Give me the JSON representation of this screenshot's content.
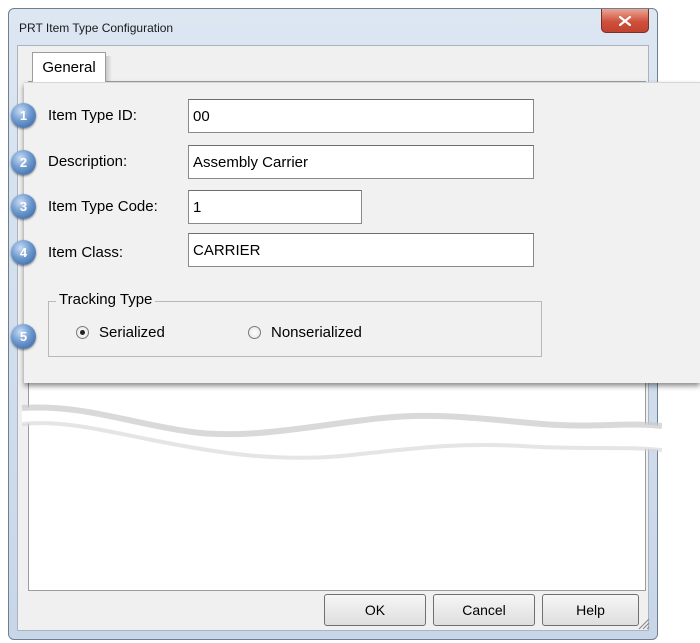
{
  "window": {
    "title": "PRT Item Type Configuration",
    "close_icon": "close-icon"
  },
  "tabs": [
    {
      "label": "General",
      "selected": true
    }
  ],
  "fields": [
    {
      "number": "1",
      "label": "Item Type ID:",
      "value": "00"
    },
    {
      "number": "2",
      "label": "Description:",
      "value": "Assembly Carrier"
    },
    {
      "number": "3",
      "label": "Item Type Code:",
      "value": "1"
    },
    {
      "number": "4",
      "label": "Item Class:",
      "value": "CARRIER"
    }
  ],
  "tracking": {
    "number": "5",
    "legend": "Tracking Type",
    "options": [
      {
        "label": "Serialized",
        "selected": true
      },
      {
        "label": "Nonserialized",
        "selected": false
      }
    ]
  },
  "buttons": {
    "ok": "OK",
    "cancel": "Cancel",
    "help": "Help"
  },
  "colors": {
    "badge": "#4f7fbf",
    "close_button": "#cf513c"
  }
}
